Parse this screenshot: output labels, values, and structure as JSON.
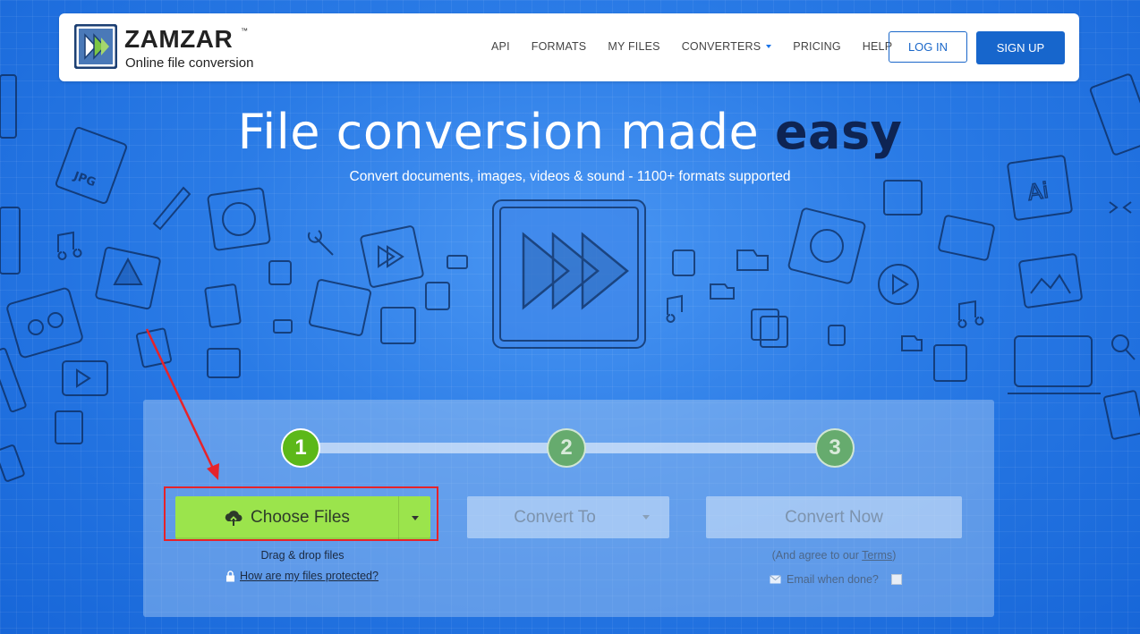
{
  "header": {
    "logo_name": "ZAMZAR",
    "logo_tm": "™",
    "logo_tagline": "Online file conversion",
    "nav": [
      {
        "label": "API"
      },
      {
        "label": "FORMATS"
      },
      {
        "label": "MY FILES"
      },
      {
        "label": "CONVERTERS",
        "has_dropdown": true
      },
      {
        "label": "PRICING"
      },
      {
        "label": "HELP"
      }
    ],
    "login_label": "LOG IN",
    "signup_label": "SIGN UP"
  },
  "hero": {
    "title_main": "File conversion made ",
    "title_emphasis": "easy",
    "subtitle": "Convert documents, images, videos & sound - 1100+ formats supported"
  },
  "converter": {
    "steps": [
      "1",
      "2",
      "3"
    ],
    "active_step": 1,
    "choose_files_label": "Choose Files",
    "drag_drop_text": "Drag & drop files",
    "protected_link": "How are my files protected?",
    "convert_to_label": "Convert To",
    "convert_now_label": "Convert Now",
    "agree_prefix": "(And agree to our ",
    "terms_link": "Terms",
    "agree_suffix": ")",
    "email_label": "Email when done?",
    "email_checked": false
  },
  "colors": {
    "background": "#1f6fde",
    "accent_green": "#9be44c",
    "step_active": "#5cb819",
    "brand_blue": "#1766cc",
    "annotation_red": "#e6232a"
  }
}
